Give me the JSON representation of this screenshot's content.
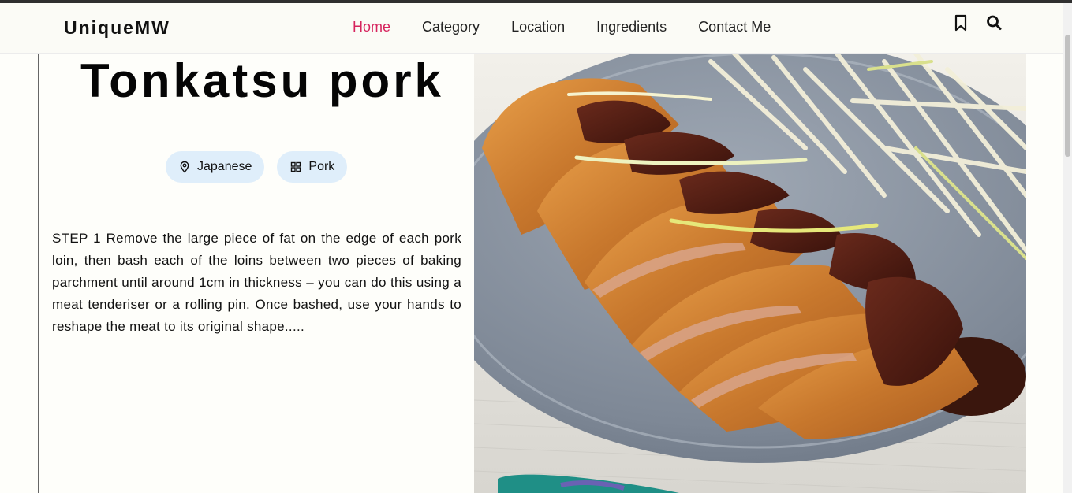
{
  "brand": "UniqueMW",
  "nav": {
    "links": [
      "Home",
      "Category",
      "Location",
      "Ingredients",
      "Contact Me"
    ],
    "active_index": 0
  },
  "icons": {
    "bookmark": "bookmark-icon",
    "search": "search-icon",
    "location": "map-pin-icon",
    "category": "grid-icon"
  },
  "recipe": {
    "title": "Tonkatsu pork",
    "location_tag": "Japanese",
    "category_tag": "Pork",
    "step_text": "STEP 1 Remove the large piece of fat on the edge of each pork loin, then bash each of the loins between two pieces of baking parchment until around 1cm in thickness – you can do this using a meat tenderiser or a rolling pin. Once bashed, use your hands to reshape the meat to its original shape....."
  },
  "colors": {
    "accent": "#d6245e",
    "chip_bg": "#dfeefa",
    "page_bg": "#fefefa"
  }
}
